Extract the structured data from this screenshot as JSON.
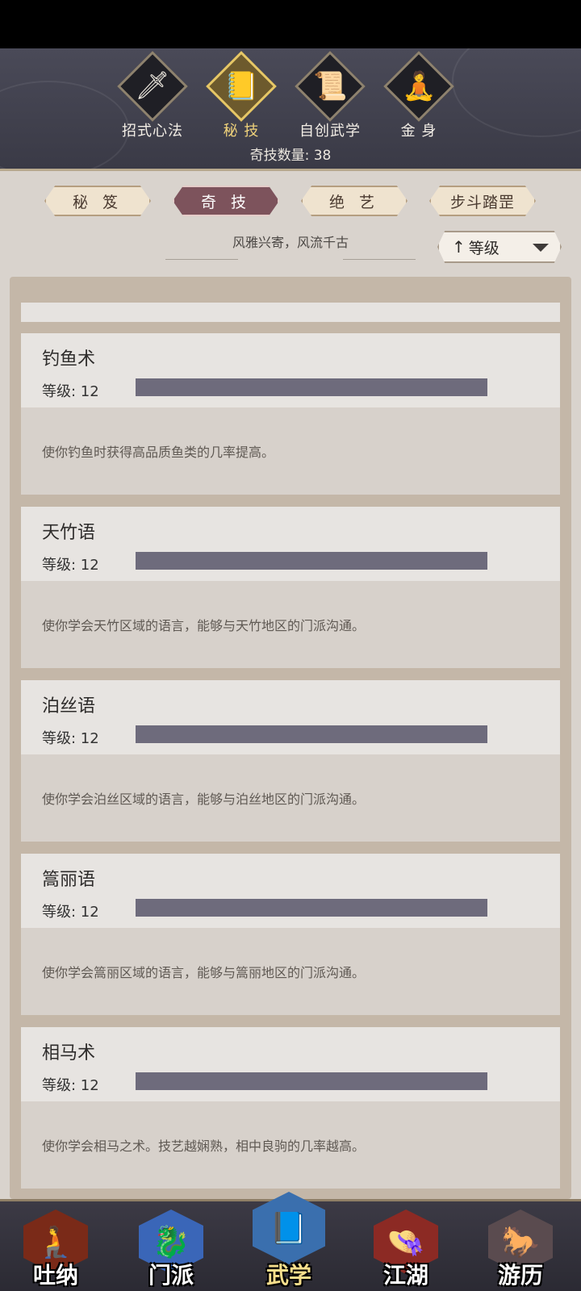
{
  "header": {
    "categories": [
      {
        "label": "招式心法",
        "icon": "sword-icon"
      },
      {
        "label": "秘 技",
        "icon": "book-icon"
      },
      {
        "label": "自创武学",
        "icon": "scroll-icon"
      },
      {
        "label": "金 身",
        "icon": "meditation-icon"
      }
    ],
    "count_text": "奇技数量: 38"
  },
  "tabs": [
    "秘 笈",
    "奇 技",
    "绝 艺",
    "步斗踏罡"
  ],
  "motto": "风雅兴寄，风流千古",
  "sort": {
    "arrow": "↑",
    "label": "等级"
  },
  "items": [
    {
      "name": "钓鱼术",
      "level": "等级: 12",
      "level_fraction": 1.0,
      "desc": "使你钓鱼时获得高品质鱼类的几率提高。"
    },
    {
      "name": "天竹语",
      "level": "等级: 12",
      "level_fraction": 1.0,
      "desc": "使你学会天竹区域的语言，能够与天竹地区的门派沟通。"
    },
    {
      "name": "泊丝语",
      "level": "等级: 12",
      "level_fraction": 1.0,
      "desc": "使你学会泊丝区域的语言，能够与泊丝地区的门派沟通。"
    },
    {
      "name": "篙丽语",
      "level": "等级: 12",
      "level_fraction": 1.0,
      "desc": "使你学会篙丽区域的语言，能够与篙丽地区的门派沟通。"
    },
    {
      "name": "相马术",
      "level": "等级: 12",
      "level_fraction": 1.0,
      "desc": "使你学会相马之术。技艺越娴熟，相中良驹的几率越高。"
    }
  ],
  "bottom_nav": [
    {
      "label": "吐纳",
      "icon": "monk-icon",
      "color": "#7a2a18"
    },
    {
      "label": "门派",
      "icon": "sect-flag-icon",
      "color": "#3a66b8"
    },
    {
      "label": "武学",
      "icon": "manual-books-icon",
      "color": "#3a6fae"
    },
    {
      "label": "江湖",
      "icon": "straw-hat-icon",
      "color": "#8c2a24"
    },
    {
      "label": "游历",
      "icon": "horse-icon",
      "color": "#5a4b4f"
    }
  ]
}
